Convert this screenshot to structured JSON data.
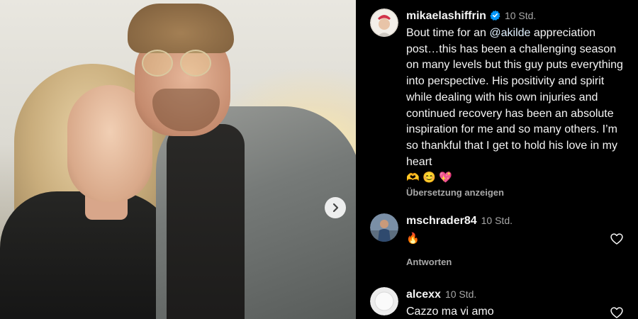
{
  "post": {
    "author": "mikaelashiffrin",
    "time": "10 Std.",
    "caption_before": "Bout time for an ",
    "caption_mention": "@akilde",
    "caption_after": " appreciation post…this has been a challenging season on many levels but this guy puts everything into perspective. His positivity and spirit while dealing with his own injuries and continued recovery has been an absolute inspiration for me and so many others. I’m so thankful that I get to hold his love in my heart",
    "caption_emojis": [
      "🫶",
      "😊",
      "💖"
    ],
    "translate_label": "Übersetzung anzeigen"
  },
  "comments": [
    {
      "user": "mschrader84",
      "time": "10 Std.",
      "text": "🔥",
      "reply_label": "Antworten"
    },
    {
      "user": "alcexx",
      "time": "10 Std.",
      "text": "Cazzo ma vi amo"
    }
  ],
  "icons": {
    "next": "chevron-right-icon",
    "like": "heart-outline-icon",
    "verified": "verified-badge-icon"
  },
  "colors": {
    "background": "#000000",
    "text": "#f5f5f5",
    "secondary": "#a8a8a8",
    "verified": "#0095f6"
  }
}
